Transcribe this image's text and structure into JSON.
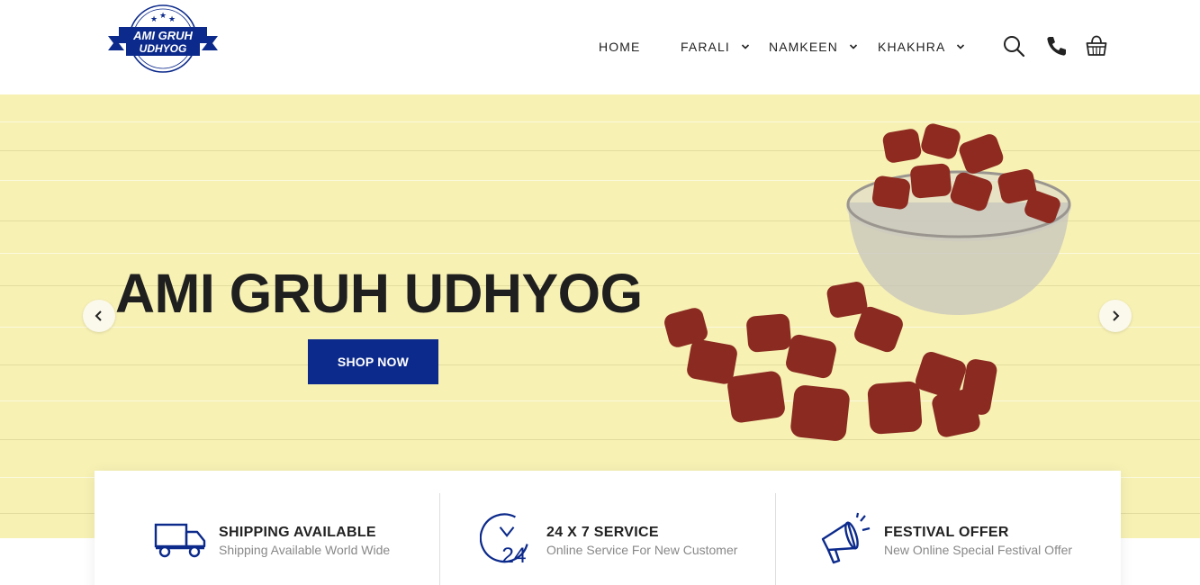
{
  "brand": {
    "logo_line1": "AMI GRUH",
    "logo_line2": "UDHYOG",
    "accent_color": "#0c2a8b"
  },
  "nav": {
    "items": [
      {
        "label": "HOME",
        "has_dropdown": false
      },
      {
        "label": "FARALI",
        "has_dropdown": true
      },
      {
        "label": "NAMKEEN",
        "has_dropdown": true
      },
      {
        "label": "KHAKHRA",
        "has_dropdown": true
      }
    ],
    "icons": [
      "search-icon",
      "phone-icon",
      "cart-icon"
    ]
  },
  "hero": {
    "title": "AMI GRUH UDHYOG",
    "cta_label": "SHOP NOW",
    "background_color": "#f7f1b4",
    "prev_icon": "chevron-left-icon",
    "next_icon": "chevron-right-icon"
  },
  "features": [
    {
      "icon": "truck-icon",
      "title": "SHIPPING AVAILABLE",
      "subtitle": "Shipping Available World Wide"
    },
    {
      "icon": "clock-24-icon",
      "title": "24 X 7 SERVICE",
      "subtitle": "Online Service For New Customer"
    },
    {
      "icon": "megaphone-icon",
      "title": "FESTIVAL OFFER",
      "subtitle": "New Online Special Festival Offer"
    }
  ]
}
